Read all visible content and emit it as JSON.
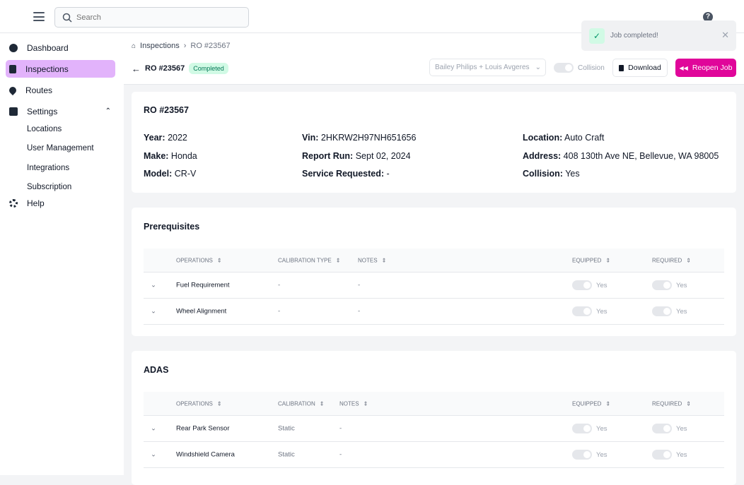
{
  "topbar": {
    "search_placeholder": "Search",
    "help_icon": "?"
  },
  "sidebar": {
    "items": [
      {
        "label": "Dashboard"
      },
      {
        "label": "Inspections"
      },
      {
        "label": "Routes"
      },
      {
        "label": "Settings"
      },
      {
        "label": "Help"
      }
    ],
    "settings_sub": [
      "Locations",
      "User Management",
      "Integrations",
      "Subscription"
    ]
  },
  "breadcrumb": {
    "root": "Inspections",
    "current": "RO #23567"
  },
  "title": {
    "text": "RO #23567",
    "status": "Completed"
  },
  "toolbar": {
    "technicians": "Bailey Philips + Louis Avgeres",
    "collision_label": "Collision",
    "download": "Download",
    "reopen": "Reopen Job"
  },
  "toast": {
    "message": "Job completed!"
  },
  "colors": {
    "accent": "#e0069a",
    "active_nav": "#e2b3fb",
    "success": "#d1fae5"
  },
  "details": {
    "title": "RO #23567",
    "col1": [
      {
        "k": "Year:",
        "v": "2022"
      },
      {
        "k": "Make:",
        "v": "Honda"
      },
      {
        "k": "Model:",
        "v": "CR-V"
      }
    ],
    "col2": [
      {
        "k": "Vin:",
        "v": "2HKRW2H97NH651656"
      },
      {
        "k": "Report Run:",
        "v": "Sept 02, 2024"
      },
      {
        "k": "Service Requested:",
        "v": "-"
      }
    ],
    "col3": [
      {
        "k": "Location:",
        "v": "Auto Craft"
      },
      {
        "k": "Address:",
        "v": "408 130th Ave NE, Bellevue, WA 98005"
      },
      {
        "k": "Collision:",
        "v": "Yes"
      }
    ]
  },
  "prereq": {
    "title": "Prerequisites",
    "headers": [
      "Operations",
      "Calibration Type",
      "Notes",
      "Equipped",
      "Required"
    ],
    "rows": [
      {
        "op": "Fuel Requirement",
        "cal": "-",
        "notes": "-",
        "equipped": "Yes",
        "required": "Yes"
      },
      {
        "op": "Wheel Alignment",
        "cal": "-",
        "notes": "-",
        "equipped": "Yes",
        "required": "Yes"
      }
    ]
  },
  "adas": {
    "title": "ADAS",
    "headers": [
      "Operations",
      "Calibration",
      "Notes",
      "Equipped",
      "Required"
    ],
    "rows": [
      {
        "op": "Rear Park Sensor",
        "cal": "Static",
        "notes": "-",
        "equipped": "Yes",
        "required": "Yes"
      },
      {
        "op": "Windshield Camera",
        "cal": "Static",
        "notes": "-",
        "equipped": "Yes",
        "required": "Yes"
      }
    ]
  }
}
